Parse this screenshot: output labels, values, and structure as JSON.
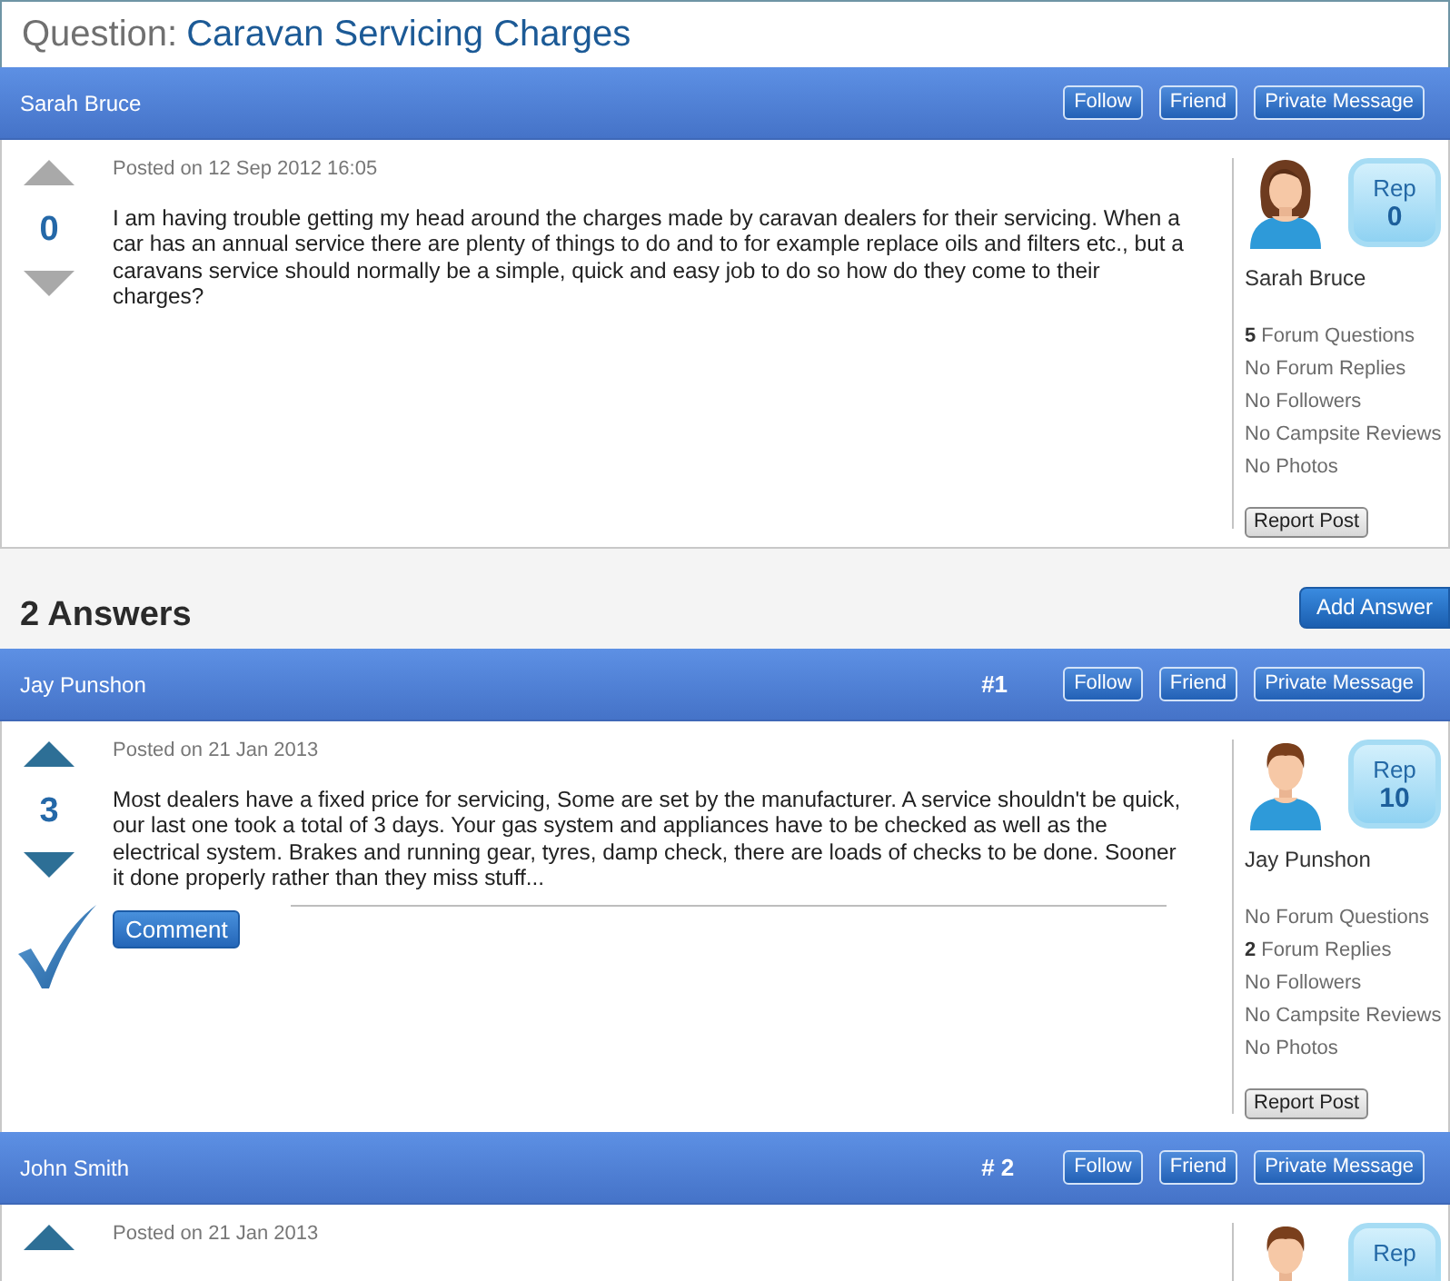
{
  "question": {
    "label": "Question:",
    "title": "Caravan Servicing Charges",
    "post": {
      "author": "Sarah Bruce",
      "actions": [
        "Follow",
        "Friend",
        "Private Message"
      ],
      "voting_enabled": false,
      "score": "0",
      "accepted": false,
      "posted": "Posted on 12 Sep 2012 16:05",
      "body": "I am having trouble getting my head around the charges made by caravan dealers for their servicing. When a car has an annual service there are plenty of things to do and to for example replace oils and filters etc., but a caravans service should normally be a simple, quick and easy job to do so how do they come to their charges?",
      "profile": {
        "avatar": {
          "kind": "female"
        },
        "rep_label": "Rep",
        "rep": "0",
        "name": "Sarah Bruce",
        "stats": [
          "**5** Forum Questions",
          "No Forum Replies",
          "No Followers",
          "No Campsite Reviews",
          "No Photos"
        ],
        "report_button": "Report Post"
      }
    }
  },
  "answers": {
    "heading": "2 Answers",
    "add_button": "Add Answer",
    "items": [
      {
        "author": "Jay Punshon",
        "number": "#1",
        "actions": [
          "Follow",
          "Friend",
          "Private Message"
        ],
        "voting_enabled": true,
        "score": "3",
        "accepted": true,
        "posted": "Posted on 21 Jan 2013",
        "body": "Most dealers have a fixed price for servicing, Some are set by the manufacturer. A service shouldn't be quick, our last one took a total of 3 days. Your gas system and appliances have to be checked as well as the electrical system. Brakes and running gear, tyres, damp check, there are loads of checks to be done. Sooner it done properly rather than they miss stuff...",
        "comment_button": "Comment",
        "profile": {
          "avatar": {
            "kind": "male"
          },
          "rep_label": "Rep",
          "rep": "10",
          "name": "Jay Punshon",
          "stats": [
            "No Forum Questions",
            "**2** Forum Replies",
            "No Followers",
            "No Campsite Reviews",
            "No Photos"
          ],
          "report_button": "Report Post"
        }
      },
      {
        "author": "John Smith",
        "number": "# 2",
        "actions": [
          "Follow",
          "Friend",
          "Private Message"
        ],
        "voting_enabled": true,
        "accepted": false,
        "posted": "Posted on 21 Jan 2013",
        "profile": {
          "avatar": {
            "kind": "male"
          },
          "rep_label": "Rep"
        }
      }
    ]
  }
}
